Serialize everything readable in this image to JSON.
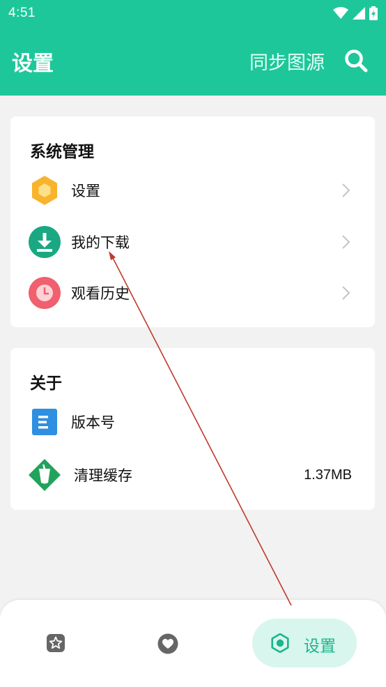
{
  "status_bar": {
    "time": "4:51"
  },
  "app_bar": {
    "title": "设置",
    "sync_label": "同步图源"
  },
  "system_section": {
    "title": "系统管理",
    "items": [
      {
        "label": "设置",
        "icon": "hexagon-settings-icon"
      },
      {
        "label": "我的下载",
        "icon": "download-icon"
      },
      {
        "label": "观看历史",
        "icon": "clock-history-icon"
      }
    ]
  },
  "about_section": {
    "title": "关于",
    "items": [
      {
        "label": "版本号",
        "icon": "document-icon"
      },
      {
        "label": "清理缓存",
        "icon": "clean-cache-icon",
        "value": "1.37MB"
      }
    ]
  },
  "bottom_nav": {
    "items": [
      {
        "icon": "home-star-icon"
      },
      {
        "icon": "heart-icon"
      },
      {
        "icon": "gear-icon",
        "label": "设置",
        "selected": true
      }
    ]
  },
  "colors": {
    "primary": "#1ec79a",
    "nav_active_bg": "#d8f6ed",
    "nav_active_text": "#1ab58b",
    "annotation_arrow": "#c0392b"
  }
}
